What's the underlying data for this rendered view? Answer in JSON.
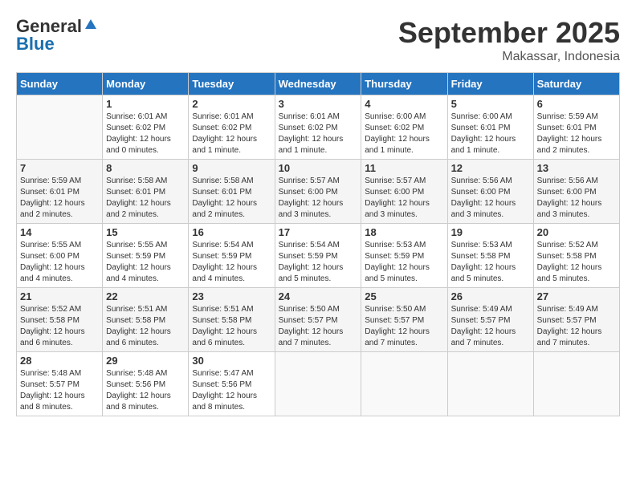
{
  "header": {
    "logo_general": "General",
    "logo_blue": "Blue",
    "month_title": "September 2025",
    "location": "Makassar, Indonesia"
  },
  "weekdays": [
    "Sunday",
    "Monday",
    "Tuesday",
    "Wednesday",
    "Thursday",
    "Friday",
    "Saturday"
  ],
  "weeks": [
    [
      {
        "day": "",
        "info": ""
      },
      {
        "day": "1",
        "info": "Sunrise: 6:01 AM\nSunset: 6:02 PM\nDaylight: 12 hours\nand 0 minutes."
      },
      {
        "day": "2",
        "info": "Sunrise: 6:01 AM\nSunset: 6:02 PM\nDaylight: 12 hours\nand 1 minute."
      },
      {
        "day": "3",
        "info": "Sunrise: 6:01 AM\nSunset: 6:02 PM\nDaylight: 12 hours\nand 1 minute."
      },
      {
        "day": "4",
        "info": "Sunrise: 6:00 AM\nSunset: 6:02 PM\nDaylight: 12 hours\nand 1 minute."
      },
      {
        "day": "5",
        "info": "Sunrise: 6:00 AM\nSunset: 6:01 PM\nDaylight: 12 hours\nand 1 minute."
      },
      {
        "day": "6",
        "info": "Sunrise: 5:59 AM\nSunset: 6:01 PM\nDaylight: 12 hours\nand 2 minutes."
      }
    ],
    [
      {
        "day": "7",
        "info": "Sunrise: 5:59 AM\nSunset: 6:01 PM\nDaylight: 12 hours\nand 2 minutes."
      },
      {
        "day": "8",
        "info": "Sunrise: 5:58 AM\nSunset: 6:01 PM\nDaylight: 12 hours\nand 2 minutes."
      },
      {
        "day": "9",
        "info": "Sunrise: 5:58 AM\nSunset: 6:01 PM\nDaylight: 12 hours\nand 2 minutes."
      },
      {
        "day": "10",
        "info": "Sunrise: 5:57 AM\nSunset: 6:00 PM\nDaylight: 12 hours\nand 3 minutes."
      },
      {
        "day": "11",
        "info": "Sunrise: 5:57 AM\nSunset: 6:00 PM\nDaylight: 12 hours\nand 3 minutes."
      },
      {
        "day": "12",
        "info": "Sunrise: 5:56 AM\nSunset: 6:00 PM\nDaylight: 12 hours\nand 3 minutes."
      },
      {
        "day": "13",
        "info": "Sunrise: 5:56 AM\nSunset: 6:00 PM\nDaylight: 12 hours\nand 3 minutes."
      }
    ],
    [
      {
        "day": "14",
        "info": "Sunrise: 5:55 AM\nSunset: 6:00 PM\nDaylight: 12 hours\nand 4 minutes."
      },
      {
        "day": "15",
        "info": "Sunrise: 5:55 AM\nSunset: 5:59 PM\nDaylight: 12 hours\nand 4 minutes."
      },
      {
        "day": "16",
        "info": "Sunrise: 5:54 AM\nSunset: 5:59 PM\nDaylight: 12 hours\nand 4 minutes."
      },
      {
        "day": "17",
        "info": "Sunrise: 5:54 AM\nSunset: 5:59 PM\nDaylight: 12 hours\nand 5 minutes."
      },
      {
        "day": "18",
        "info": "Sunrise: 5:53 AM\nSunset: 5:59 PM\nDaylight: 12 hours\nand 5 minutes."
      },
      {
        "day": "19",
        "info": "Sunrise: 5:53 AM\nSunset: 5:58 PM\nDaylight: 12 hours\nand 5 minutes."
      },
      {
        "day": "20",
        "info": "Sunrise: 5:52 AM\nSunset: 5:58 PM\nDaylight: 12 hours\nand 5 minutes."
      }
    ],
    [
      {
        "day": "21",
        "info": "Sunrise: 5:52 AM\nSunset: 5:58 PM\nDaylight: 12 hours\nand 6 minutes."
      },
      {
        "day": "22",
        "info": "Sunrise: 5:51 AM\nSunset: 5:58 PM\nDaylight: 12 hours\nand 6 minutes."
      },
      {
        "day": "23",
        "info": "Sunrise: 5:51 AM\nSunset: 5:58 PM\nDaylight: 12 hours\nand 6 minutes."
      },
      {
        "day": "24",
        "info": "Sunrise: 5:50 AM\nSunset: 5:57 PM\nDaylight: 12 hours\nand 7 minutes."
      },
      {
        "day": "25",
        "info": "Sunrise: 5:50 AM\nSunset: 5:57 PM\nDaylight: 12 hours\nand 7 minutes."
      },
      {
        "day": "26",
        "info": "Sunrise: 5:49 AM\nSunset: 5:57 PM\nDaylight: 12 hours\nand 7 minutes."
      },
      {
        "day": "27",
        "info": "Sunrise: 5:49 AM\nSunset: 5:57 PM\nDaylight: 12 hours\nand 7 minutes."
      }
    ],
    [
      {
        "day": "28",
        "info": "Sunrise: 5:48 AM\nSunset: 5:57 PM\nDaylight: 12 hours\nand 8 minutes."
      },
      {
        "day": "29",
        "info": "Sunrise: 5:48 AM\nSunset: 5:56 PM\nDaylight: 12 hours\nand 8 minutes."
      },
      {
        "day": "30",
        "info": "Sunrise: 5:47 AM\nSunset: 5:56 PM\nDaylight: 12 hours\nand 8 minutes."
      },
      {
        "day": "",
        "info": ""
      },
      {
        "day": "",
        "info": ""
      },
      {
        "day": "",
        "info": ""
      },
      {
        "day": "",
        "info": ""
      }
    ]
  ]
}
